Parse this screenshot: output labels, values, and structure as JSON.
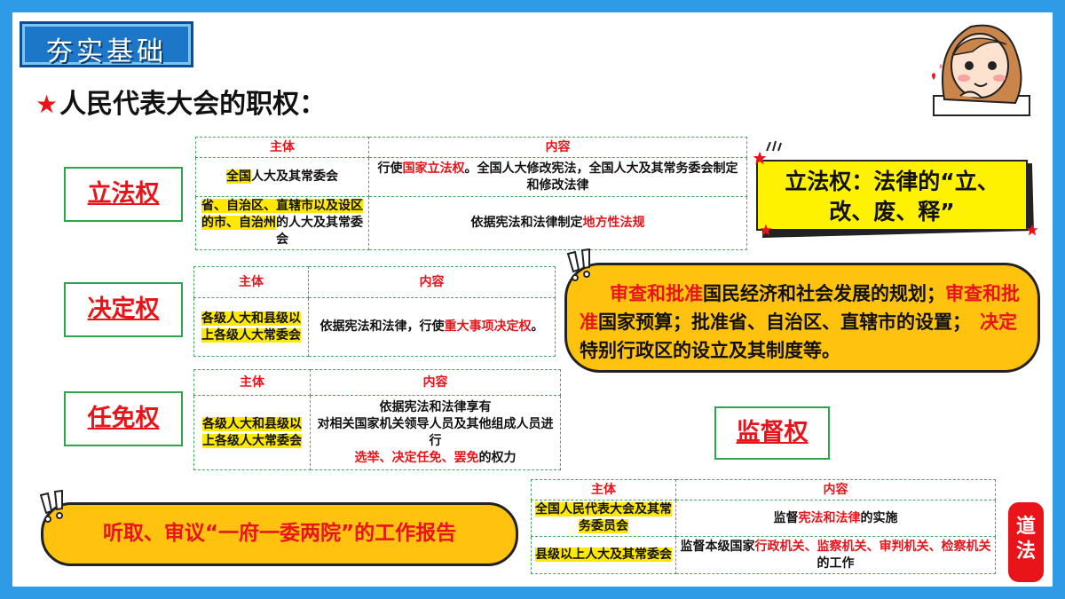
{
  "banner": {
    "label": "夯实基础"
  },
  "title": {
    "star": "★",
    "text": "人民代表大会的职权："
  },
  "powers": {
    "legislative": "立法权",
    "decision": "决定权",
    "appointment": "任免权",
    "supervision": "监督权"
  },
  "legislative_table": {
    "headers": [
      "主体",
      "内容"
    ],
    "row1": {
      "subject_hl": "全国",
      "subject_rest": "人大及其常委会",
      "content_a": "行使",
      "content_red": "国家立法权",
      "content_b": "。全国人大修改宪法，全国人大及其常务委会制定和修改法律"
    },
    "row2": {
      "subject_hl": "省、自治区、直辖市以及设区的市、自治州",
      "subject_rest": "的人大及其常委会",
      "content_a": "依据宪法和法律制定",
      "content_red": "地方性法规"
    }
  },
  "decision_table": {
    "headers": [
      "主体",
      "内容"
    ],
    "subject": "各级人大和县级以上各级人大常委会",
    "content_a": "依据宪法和法律，行使",
    "content_red": "重大事项决定权",
    "content_b": "。"
  },
  "appointment_table": {
    "headers": [
      "主体",
      "内容"
    ],
    "subject": "各级人大和县级以上各级人大常委会",
    "content_line1": "依据宪法和法律享有",
    "content_line2": "对相关国家机关领导人员及其他组成人员进行",
    "content_red": "选举、决定任免、罢免",
    "content_b": "的权力"
  },
  "supervision_table": {
    "headers": [
      "主体",
      "内容"
    ],
    "row1": {
      "subject_hl": "全国人民代表大会及其常务委员会",
      "content_a": "监督",
      "content_red": "宪法和法律",
      "content_b": "的实施"
    },
    "row2": {
      "subject_hl": "县级以上人大及其常委会",
      "content_a": "监督本级国家",
      "content_red": "行政机关、监察机关、审判机关、检察机关",
      "content_b": "的工作"
    }
  },
  "note_legislative": "立法权：法律的“立、改、废、释”",
  "note_decision": {
    "r1": "审查和批准",
    "t1": "国民经济和社会发展的规划；",
    "r2": "审查和批准",
    "t2": "国家预算；批准省、自治区、直辖市的设置；",
    "r3": "决定",
    "t3": "特别行政区的设立及其制度等。"
  },
  "note_report": "听取、审议“一府一委两院”的工作报告",
  "seal": {
    "label": "道法"
  },
  "colors": {
    "accent_red": "#e8141a",
    "bubble_yellow": "#ffc20e",
    "frame_blue": "#2f9ae6",
    "border_green": "#2ea44f",
    "highlight": "#ffe900"
  }
}
